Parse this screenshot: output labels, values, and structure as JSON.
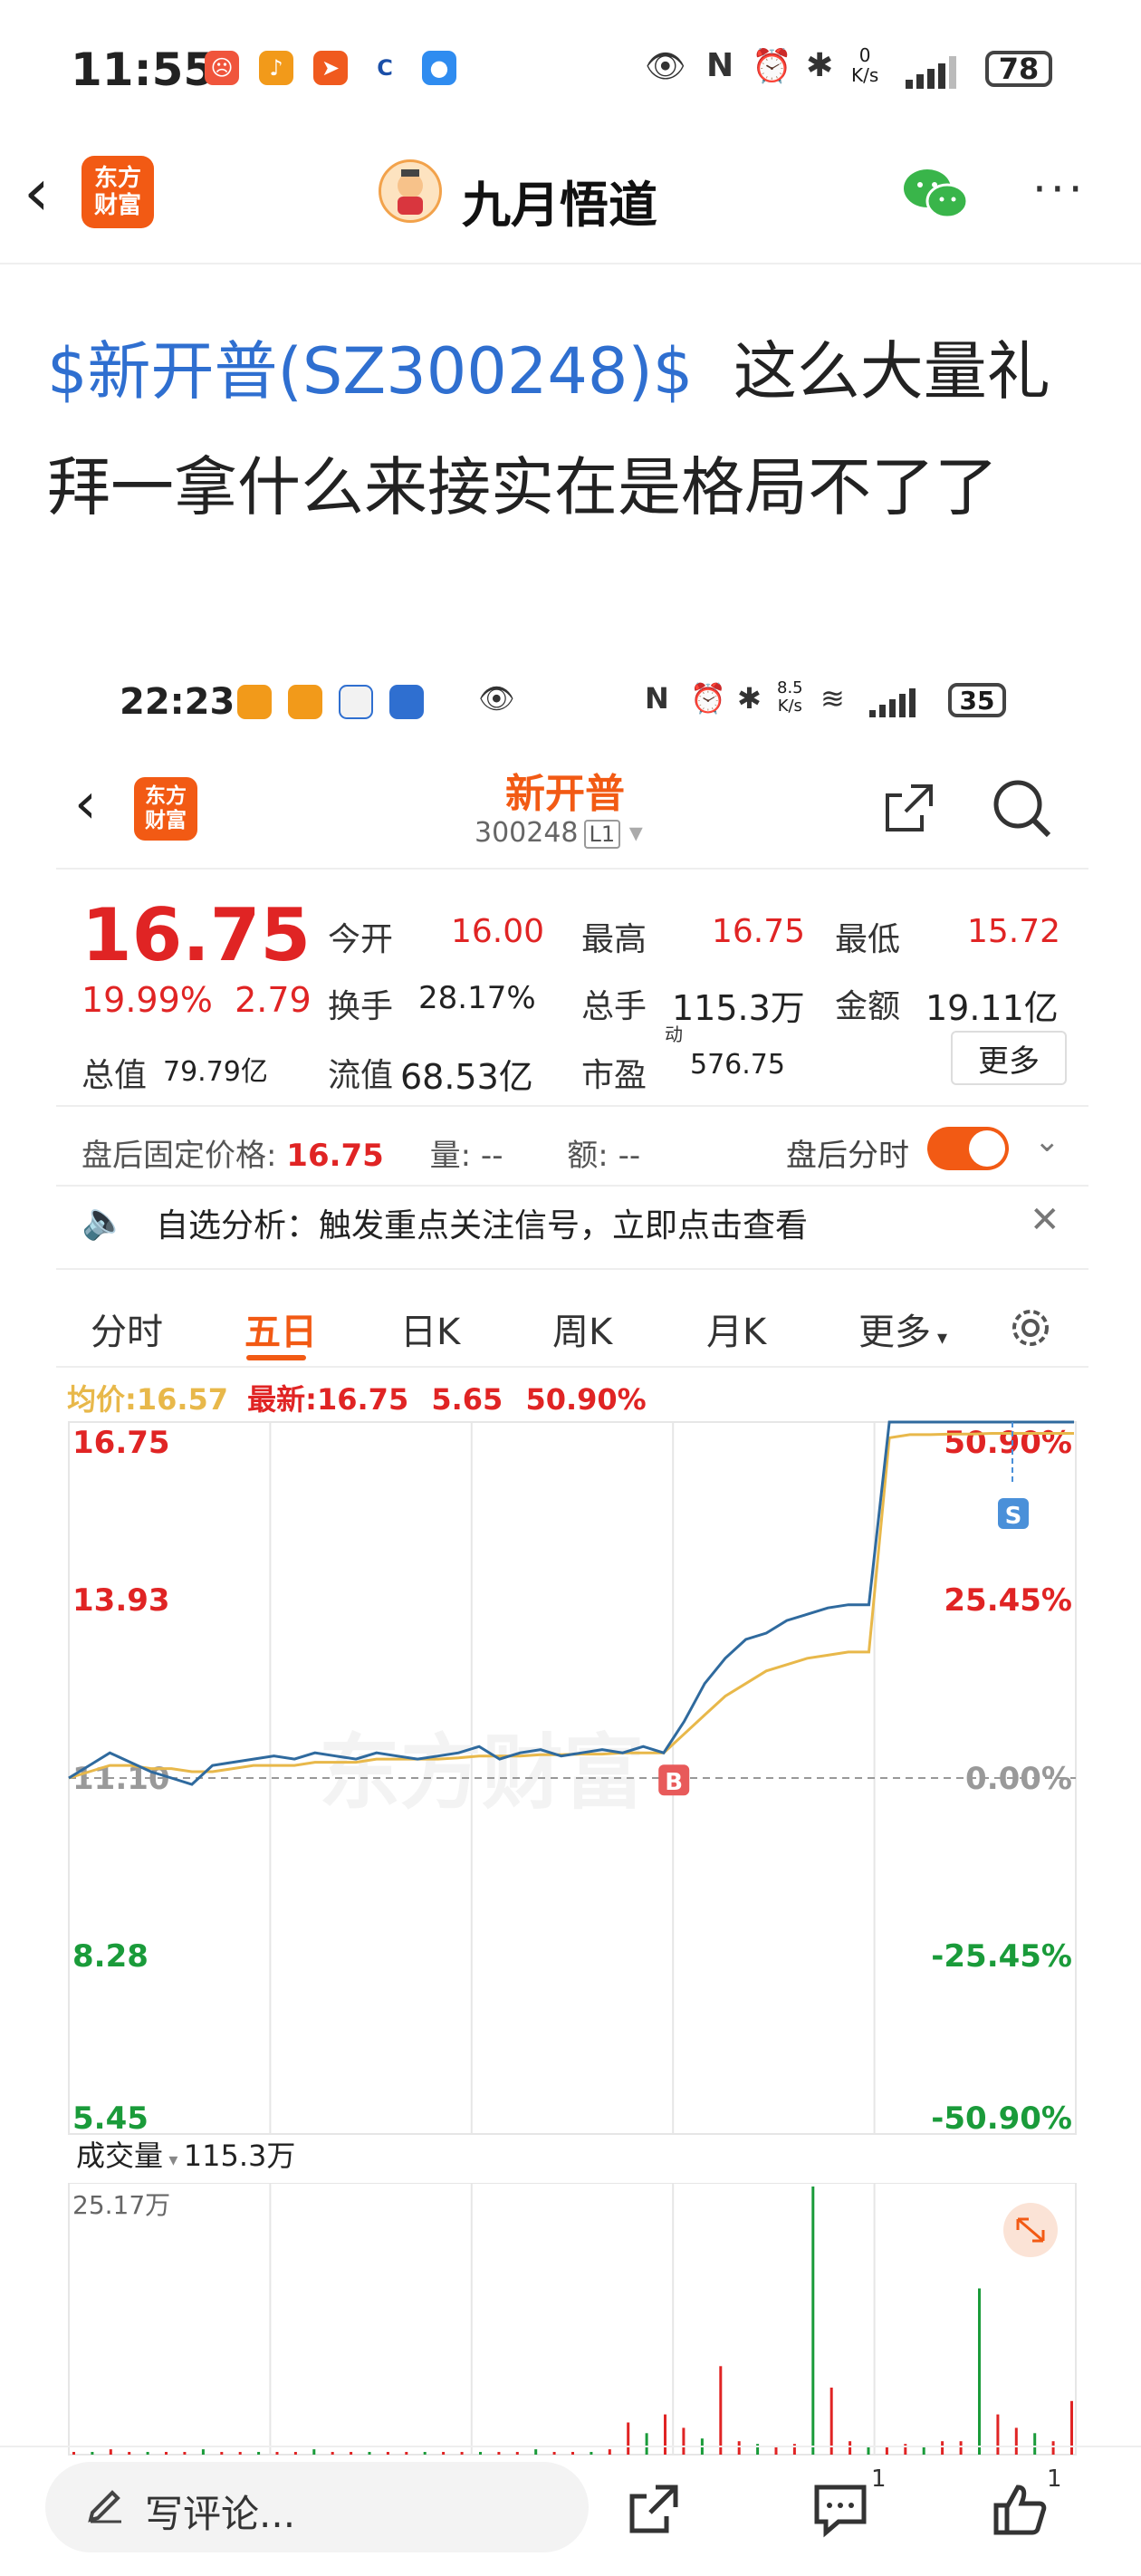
{
  "status_bar": {
    "time": "11:55",
    "net_speed": "0\nK/s",
    "battery": "78"
  },
  "header": {
    "back": "‹",
    "logo": "东方\n财富",
    "title": "九月悟道"
  },
  "post": {
    "tag": "$新开普(SZ300248)$",
    "text": "这么大量礼拜一拿什么来接实在是格局不了了"
  },
  "inner": {
    "status": {
      "time": "22:23",
      "net_speed": "8.5\nK/s",
      "battery": "35"
    },
    "stock_name": "新开普",
    "stock_code": "300248",
    "level": "L1",
    "price": "16.75",
    "change_pct": "19.99%",
    "change_amt": "2.79",
    "quote": [
      {
        "label": "今开",
        "value": "16.00",
        "color": "r"
      },
      {
        "label": "最高",
        "value": "16.75",
        "color": "r"
      },
      {
        "label": "最低",
        "value": "15.72",
        "color": "r"
      },
      {
        "label": "换手",
        "value": "28.17%",
        "color": "k"
      },
      {
        "label": "总手",
        "value": "115.3万",
        "color": "k"
      },
      {
        "label": "金额",
        "value": "19.11亿",
        "color": "k"
      },
      {
        "label": "总值",
        "value": "79.79亿",
        "color": "k"
      },
      {
        "label": "流值",
        "value": "68.53亿",
        "color": "k"
      },
      {
        "label": "市盈",
        "value": "576.75",
        "color": "k"
      }
    ],
    "pe_sup": "动",
    "more": "更多",
    "after_hours": {
      "label": "盘后固定价格:",
      "price": "16.75",
      "vol_label": "量:",
      "vol": "--",
      "amt_label": "额:",
      "amt": "--",
      "toggle_label": "盘后分时"
    },
    "alert": "自选分析：触发重点关注信号，立即点击查看",
    "tabs": [
      "分时",
      "五日",
      "日K",
      "周K",
      "月K",
      "更多"
    ],
    "active_tab": "五日",
    "avg_label": "均价:",
    "avg_value": "16.57",
    "latest_label": "最新:",
    "latest_value": "16.75",
    "latest_chg": "5.65",
    "latest_pct": "50.90%",
    "watermark": "东方财富",
    "volume_title": "成交量",
    "volume_total": "115.3万",
    "volume_max": "25.17万",
    "marker_b": "B",
    "marker_s": "S",
    "colors": {
      "up": "#e02424",
      "down": "#1a9b3a",
      "price_line": "#2f6a9e",
      "avg_line": "#e8b84a",
      "accent": "#f25a14"
    }
  },
  "chart_data": {
    "type": "line",
    "title": "",
    "xlabel": "",
    "ylabel": "",
    "ylim": [
      5.45,
      16.75
    ],
    "y_ticks_left": [
      "16.75",
      "13.93",
      "11.10",
      "8.28",
      "5.45"
    ],
    "y_ticks_right": [
      "50.90%",
      "25.45%",
      "0.00%",
      "-25.45%",
      "-50.90%"
    ],
    "days": 5,
    "series": [
      {
        "values": [
          11.1,
          11.3,
          11.5,
          11.35,
          11.2,
          11.1,
          11.0,
          11.3,
          11.35,
          11.4,
          11.45,
          11.4,
          11.5,
          11.45,
          11.4,
          11.5,
          11.45,
          11.4,
          11.45,
          11.5,
          11.6,
          11.4,
          11.5,
          11.55,
          11.45,
          11.5,
          11.55,
          11.5,
          11.6,
          11.5,
          12.0,
          12.6,
          13.0,
          13.3,
          13.4,
          13.6,
          13.7,
          13.8,
          13.85,
          13.85,
          16.75,
          16.75,
          16.75,
          16.75,
          16.75,
          16.75,
          16.75,
          16.75,
          16.75,
          16.75
        ]
      },
      {
        "values": [
          11.1,
          11.2,
          11.3,
          11.3,
          11.25,
          11.25,
          11.2,
          11.2,
          11.25,
          11.3,
          11.3,
          11.3,
          11.35,
          11.35,
          11.35,
          11.4,
          11.4,
          11.4,
          11.4,
          11.42,
          11.45,
          11.45,
          11.45,
          11.47,
          11.47,
          11.48,
          11.48,
          11.5,
          11.5,
          11.5,
          11.8,
          12.1,
          12.4,
          12.6,
          12.8,
          12.9,
          13.0,
          13.05,
          13.1,
          13.1,
          16.5,
          16.55,
          16.55,
          16.56,
          16.56,
          16.57,
          16.57,
          16.57,
          16.57,
          16.57
        ]
      }
    ],
    "volume": {
      "max": "25.17万",
      "bars": [
        0.01,
        0.01,
        0.02,
        0.01,
        0.01,
        0.01,
        0.01,
        0.02,
        0.01,
        0.01,
        0.01,
        0.01,
        0.01,
        0.02,
        0.01,
        0.01,
        0.01,
        0.01,
        0.01,
        0.01,
        0.01,
        0.01,
        0.01,
        0.01,
        0.01,
        0.02,
        0.01,
        0.01,
        0.01,
        0.02,
        0.12,
        0.08,
        0.15,
        0.1,
        0.06,
        0.33,
        0.05,
        0.04,
        0.03,
        0.04,
        1.0,
        0.25,
        0.05,
        0.03,
        0.03,
        0.04,
        0.03,
        0.05,
        0.05,
        0.62,
        0.15,
        0.1,
        0.08,
        0.05,
        0.2
      ]
    }
  }
}
